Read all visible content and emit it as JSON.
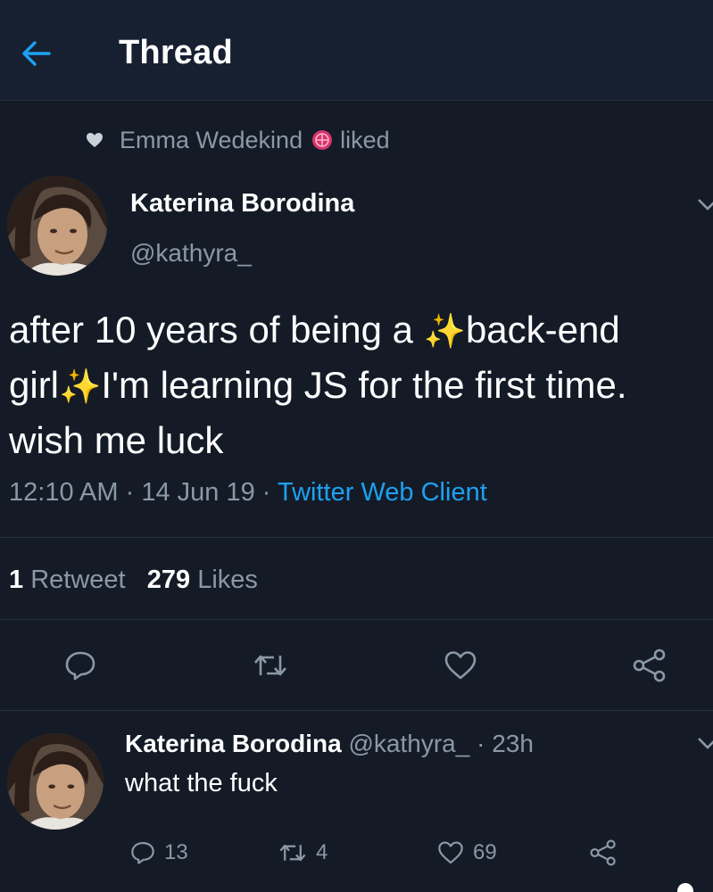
{
  "header": {
    "title": "Thread",
    "back_icon": "arrow-left-icon"
  },
  "liked_by": {
    "name": "Emma Wedekind",
    "action": "liked"
  },
  "tweet": {
    "author_name": "Katerina Borodina",
    "author_handle": "@kathyra_",
    "text_part1": "after 10 years of being a ",
    "text_part2": "back-end girl",
    "text_part3": "I'm learning JS for the first time. wish me luck",
    "emoji": "✨",
    "time": "12:10 AM",
    "date": "14 Jun 19",
    "separator": "·",
    "client": "Twitter Web Client",
    "retweet_count": "1",
    "retweet_label": "Retweet",
    "like_count": "279",
    "like_label": "Likes"
  },
  "reply": {
    "author_name": "Katerina Borodina",
    "author_handle": "@kathyra_",
    "time_ago": "23h",
    "text": "what the fuck",
    "reply_count": "13",
    "retweet_count": "4",
    "like_count": "69"
  },
  "colors": {
    "background": "#141b27",
    "header": "#172030",
    "accent": "#1da1f2",
    "muted": "#8b98a5",
    "divider": "#28323f"
  }
}
